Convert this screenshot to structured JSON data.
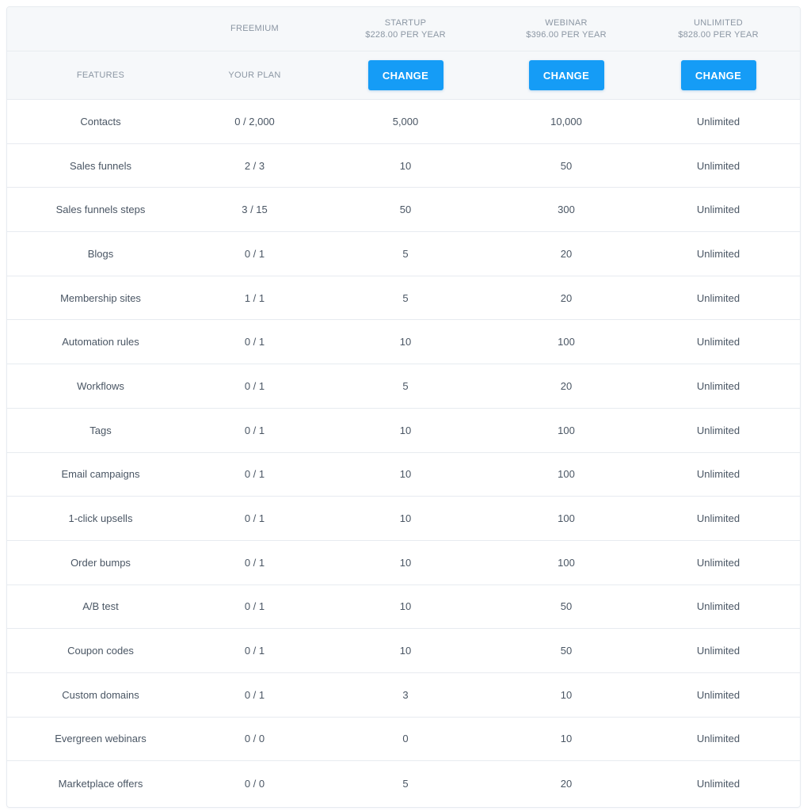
{
  "accent_color": "#159cf6",
  "plans": [
    {
      "name": "FREEMIUM",
      "price": ""
    },
    {
      "name": "STARTUP",
      "price": "$228.00 PER YEAR"
    },
    {
      "name": "WEBINAR",
      "price": "$396.00 PER YEAR"
    },
    {
      "name": "UNLIMITED",
      "price": "$828.00 PER YEAR"
    }
  ],
  "features_label": "FEATURES",
  "current_plan_label": "YOUR PLAN",
  "change_label": "CHANGE",
  "rows": [
    {
      "feature": "Contacts",
      "values": [
        "0 / 2,000",
        "5,000",
        "10,000",
        "Unlimited"
      ]
    },
    {
      "feature": "Sales funnels",
      "values": [
        "2 / 3",
        "10",
        "50",
        "Unlimited"
      ]
    },
    {
      "feature": "Sales funnels steps",
      "values": [
        "3 / 15",
        "50",
        "300",
        "Unlimited"
      ]
    },
    {
      "feature": "Blogs",
      "values": [
        "0 / 1",
        "5",
        "20",
        "Unlimited"
      ]
    },
    {
      "feature": "Membership sites",
      "values": [
        "1 / 1",
        "5",
        "20",
        "Unlimited"
      ]
    },
    {
      "feature": "Automation rules",
      "values": [
        "0 / 1",
        "10",
        "100",
        "Unlimited"
      ]
    },
    {
      "feature": "Workflows",
      "values": [
        "0 / 1",
        "5",
        "20",
        "Unlimited"
      ]
    },
    {
      "feature": "Tags",
      "values": [
        "0 / 1",
        "10",
        "100",
        "Unlimited"
      ]
    },
    {
      "feature": "Email campaigns",
      "values": [
        "0 / 1",
        "10",
        "100",
        "Unlimited"
      ]
    },
    {
      "feature": "1-click upsells",
      "values": [
        "0 / 1",
        "10",
        "100",
        "Unlimited"
      ]
    },
    {
      "feature": "Order bumps",
      "values": [
        "0 / 1",
        "10",
        "100",
        "Unlimited"
      ]
    },
    {
      "feature": "A/B test",
      "values": [
        "0 / 1",
        "10",
        "50",
        "Unlimited"
      ]
    },
    {
      "feature": "Coupon codes",
      "values": [
        "0 / 1",
        "10",
        "50",
        "Unlimited"
      ]
    },
    {
      "feature": "Custom domains",
      "values": [
        "0 / 1",
        "3",
        "10",
        "Unlimited"
      ]
    },
    {
      "feature": "Evergreen webinars",
      "values": [
        "0 / 0",
        "0",
        "10",
        "Unlimited"
      ]
    },
    {
      "feature": "Marketplace offers",
      "values": [
        "0 / 0",
        "5",
        "20",
        "Unlimited"
      ]
    }
  ]
}
